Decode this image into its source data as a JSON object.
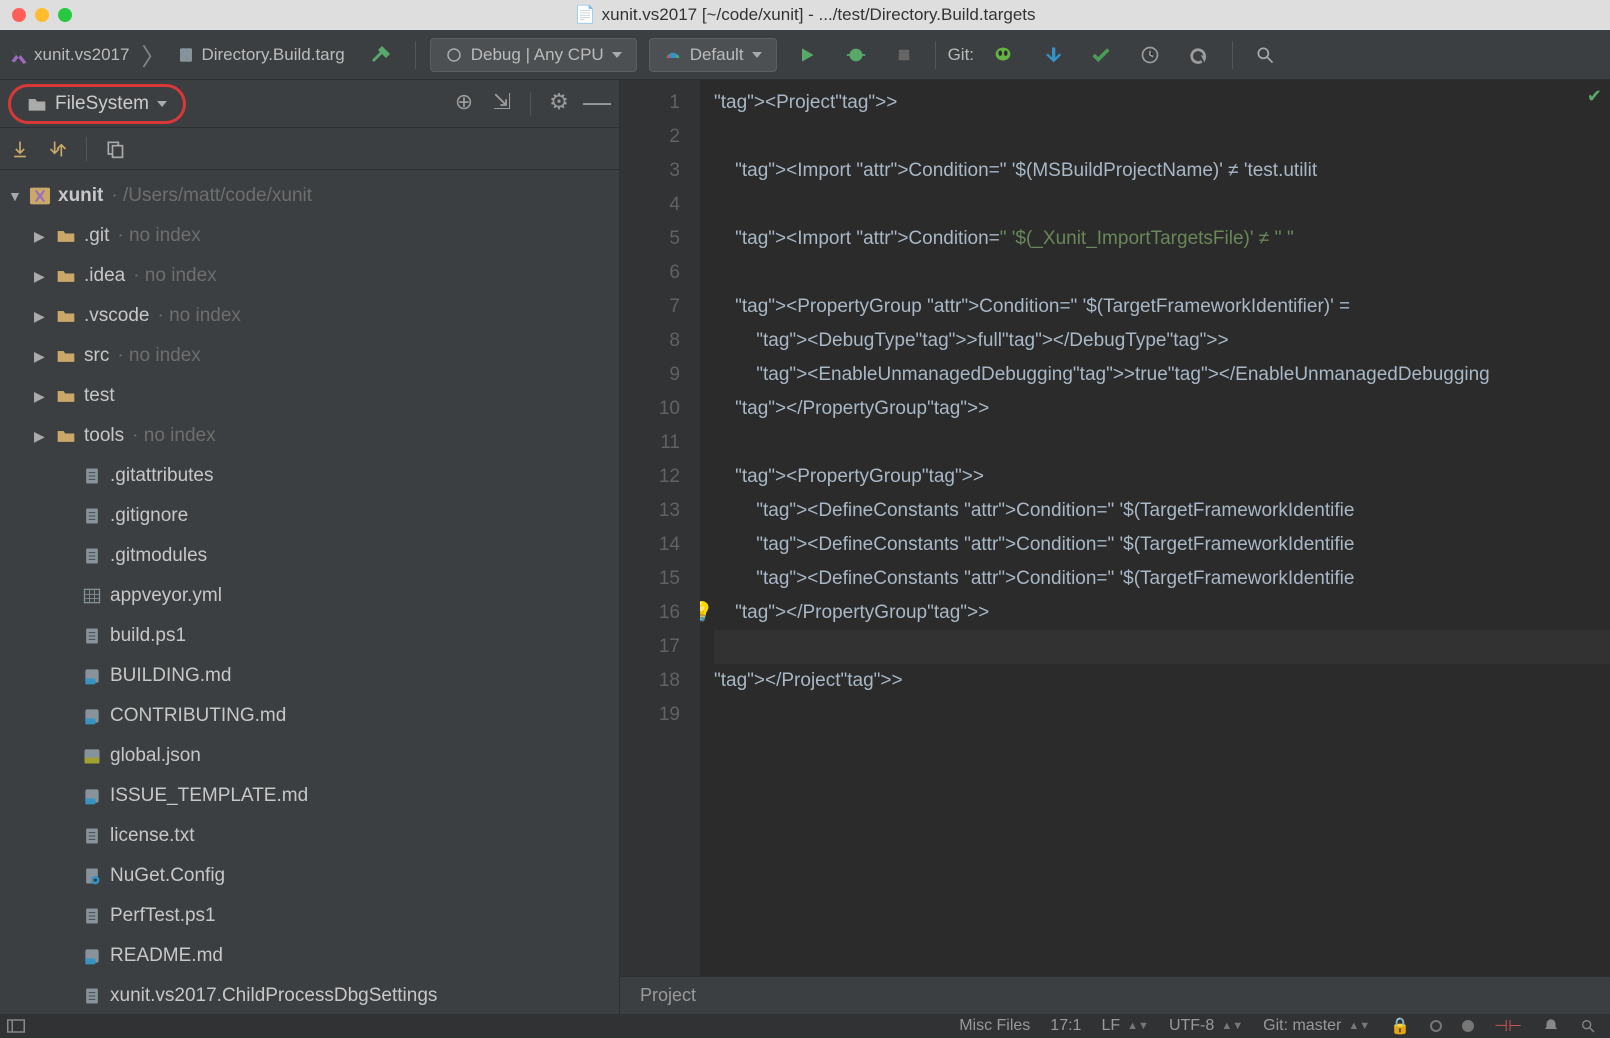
{
  "titlebar": {
    "title": "xunit.vs2017 [~/code/xunit] - .../test/Directory.Build.targets"
  },
  "toolbar": {
    "breadcrumbs": [
      "xunit.vs2017",
      "Directory.Build.targ"
    ],
    "config_label": "Debug | Any CPU",
    "run_label": "Default",
    "git_label": "Git:"
  },
  "views": {
    "selector_label": "FileSystem"
  },
  "tree": {
    "root": {
      "name": "xunit",
      "path": "/Users/matt/code/xunit"
    },
    "folders": [
      {
        "name": ".git",
        "hint": "no index"
      },
      {
        "name": ".idea",
        "hint": "no index"
      },
      {
        "name": ".vscode",
        "hint": "no index"
      },
      {
        "name": "src",
        "hint": "no index"
      },
      {
        "name": "test",
        "hint": ""
      },
      {
        "name": "tools",
        "hint": "no index"
      }
    ],
    "files": [
      {
        "name": ".gitattributes",
        "icon": "file"
      },
      {
        "name": ".gitignore",
        "icon": "file"
      },
      {
        "name": ".gitmodules",
        "icon": "file"
      },
      {
        "name": "appveyor.yml",
        "icon": "grid"
      },
      {
        "name": "build.ps1",
        "icon": "file"
      },
      {
        "name": "BUILDING.md",
        "icon": "md"
      },
      {
        "name": "CONTRIBUTING.md",
        "icon": "md"
      },
      {
        "name": "global.json",
        "icon": "json"
      },
      {
        "name": "ISSUE_TEMPLATE.md",
        "icon": "md"
      },
      {
        "name": "license.txt",
        "icon": "file"
      },
      {
        "name": "NuGet.Config",
        "icon": "cfg"
      },
      {
        "name": "PerfTest.ps1",
        "icon": "file"
      },
      {
        "name": "README.md",
        "icon": "md"
      },
      {
        "name": "xunit.vs2017.ChildProcessDbgSettings",
        "icon": "file"
      }
    ]
  },
  "editor": {
    "lines": [
      "<Project>",
      "",
      "    <Import Condition=\" '$(MSBuildProjectName)' ≠ 'test.utilit",
      "",
      "    <Import Condition=\" '$(_Xunit_ImportTargetsFile)' ≠ '' \" ",
      "",
      "    <PropertyGroup Condition=\" '$(TargetFrameworkIdentifier)' =",
      "        <DebugType>full</DebugType>",
      "        <EnableUnmanagedDebugging>true</EnableUnmanagedDebugging",
      "    </PropertyGroup>",
      "",
      "    <PropertyGroup>",
      "        <DefineConstants Condition=\" '$(TargetFrameworkIdentifie",
      "        <DefineConstants Condition=\" '$(TargetFrameworkIdentifie",
      "        <DefineConstants Condition=\" '$(TargetFrameworkIdentifie",
      "    </PropertyGroup>",
      "",
      "</Project>",
      ""
    ],
    "breadcrumb": "Project"
  },
  "statusbar": {
    "context": "Misc Files",
    "pos": "17:1",
    "le": "LF",
    "enc": "UTF-8",
    "git": "Git: master"
  }
}
